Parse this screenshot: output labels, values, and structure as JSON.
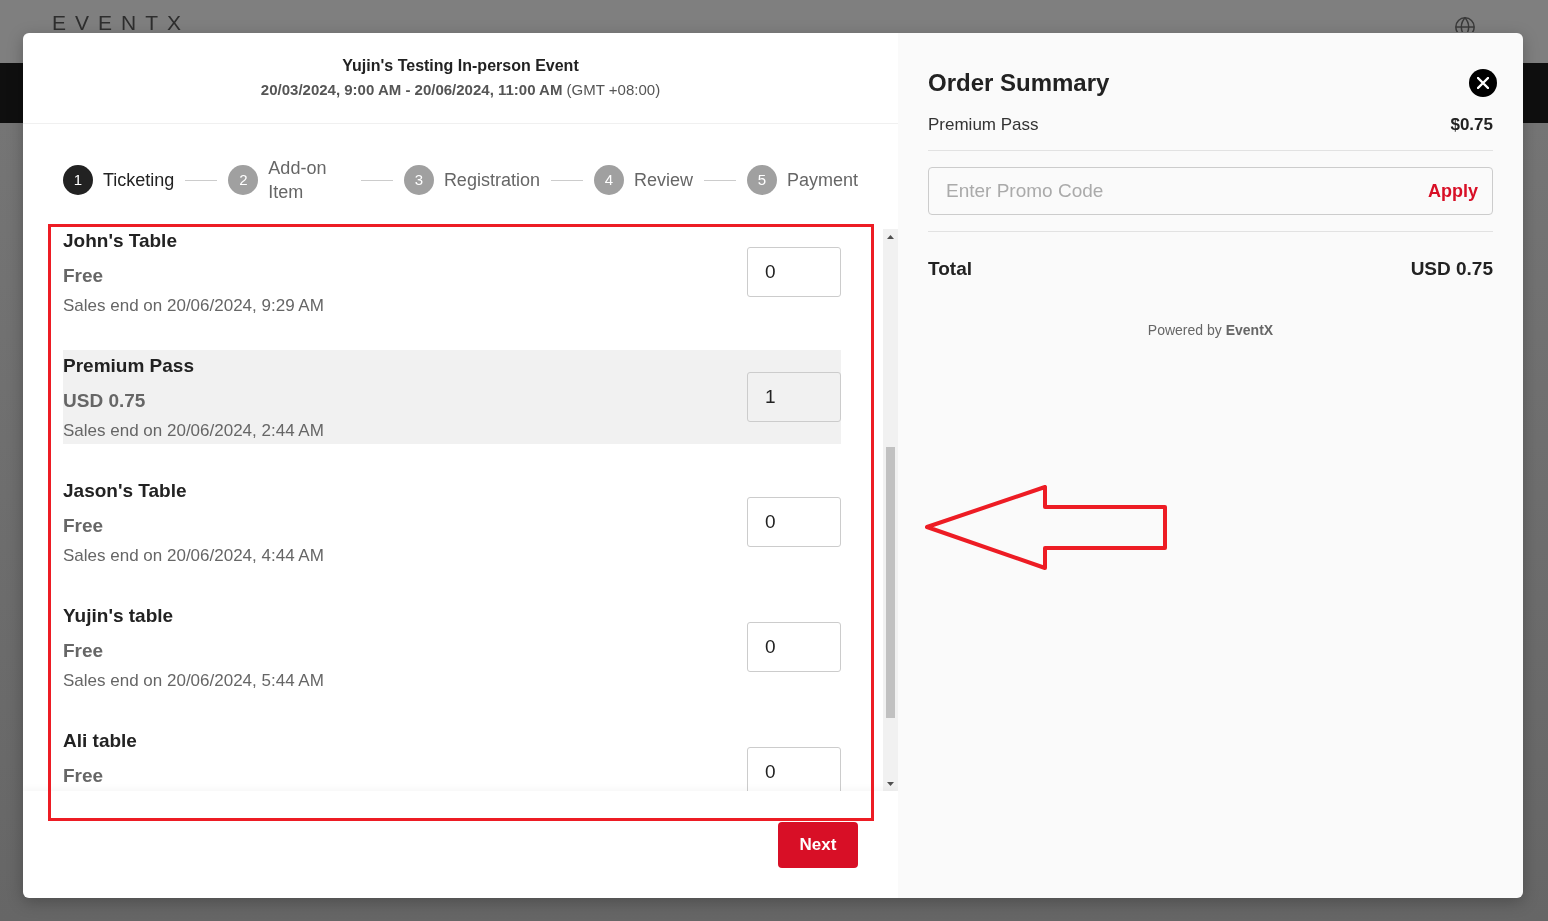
{
  "page_header": {
    "logo": "EVENTX"
  },
  "event": {
    "title": "Yujin's Testing In-person Event",
    "dates": "**20/03/2024, 9:00 AM - 20/06/2024, 11:00 AM** (GMT +08:00)"
  },
  "steps": [
    {
      "number": "1",
      "label": "Ticketing",
      "selected": true
    },
    {
      "number": "2",
      "label": "Add-on Item",
      "selected": false
    },
    {
      "number": "3",
      "label": "Registration",
      "selected": false
    },
    {
      "number": "4",
      "label": "Review",
      "selected": false
    },
    {
      "number": "5",
      "label": "Payment",
      "selected": false
    }
  ],
  "tickets": [
    {
      "name": "John's Table",
      "price": "Free",
      "sales_end": "Sales end on 20/06/2024, 9:29 AM",
      "quantity": "0",
      "selected": false
    },
    {
      "name": "Premium Pass",
      "price": "USD 0.75",
      "sales_end": "Sales end on 20/06/2024, 2:44 AM",
      "quantity": "1",
      "selected": true
    },
    {
      "name": "Jason's Table",
      "price": "Free",
      "sales_end": "Sales end on 20/06/2024, 4:44 AM",
      "quantity": "0",
      "selected": false
    },
    {
      "name": "Yujin's table",
      "price": "Free",
      "sales_end": "Sales end on 20/06/2024, 5:44 AM",
      "quantity": "0",
      "selected": false
    },
    {
      "name": "Ali table",
      "price": "Free",
      "quantity": "0",
      "selected": false
    }
  ],
  "next_button": "Next",
  "order_summary": {
    "title": "Order Summary",
    "items": [
      {
        "name": "Premium Pass",
        "amount": "$0.75"
      }
    ],
    "promo": {
      "placeholder": "Enter Promo Code",
      "button": "Apply"
    },
    "total": {
      "label": "Total",
      "value": "USD 0.75"
    },
    "powered_by": "Powered by **EventX**"
  }
}
